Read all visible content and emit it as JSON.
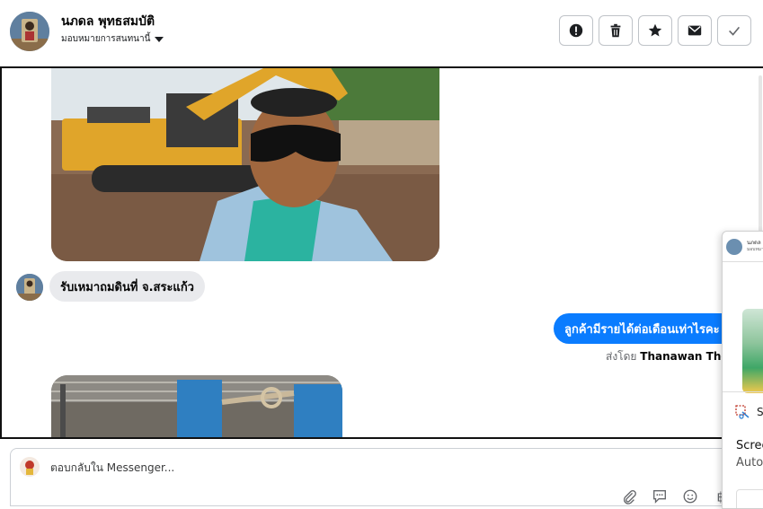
{
  "header": {
    "contact_name": "นภดล พุทธสมบัติ",
    "assign_label": "มอบหมายการสนทนานี้",
    "actions": [
      {
        "icon": "alert-icon",
        "label": "Mark as spam"
      },
      {
        "icon": "trash-icon",
        "label": "Delete"
      },
      {
        "icon": "star-icon",
        "label": "Follow up"
      },
      {
        "icon": "envelope-icon",
        "label": "Mark as unread"
      },
      {
        "icon": "check-icon",
        "label": "Mark as done"
      }
    ]
  },
  "messages": {
    "incoming_text": "รับเหมาถมดินที่ จ.สระแก้ว",
    "outgoing_text": "ลูกค้ามีรายได้ต่อเดือนเท่าไรคะ",
    "sent_by_prefix": "ส่งโดย",
    "sent_by_name": "Thanawan Thon"
  },
  "reply": {
    "placeholder": "ตอบกลับใน Messenger...",
    "tools": [
      "paperclip-icon",
      "chat-bubble-icon",
      "emoji-icon",
      "baht-icon"
    ]
  },
  "overlay": {
    "mini_name": "นภดล",
    "mini_sub": "มอบหมาย",
    "snip_label": "S",
    "title": "Scree",
    "subtitle": "Auto"
  },
  "colors": {
    "accent_blue": "#0a7cff",
    "bubble_gray": "#e9eaed",
    "border": "#bfc3c8"
  }
}
